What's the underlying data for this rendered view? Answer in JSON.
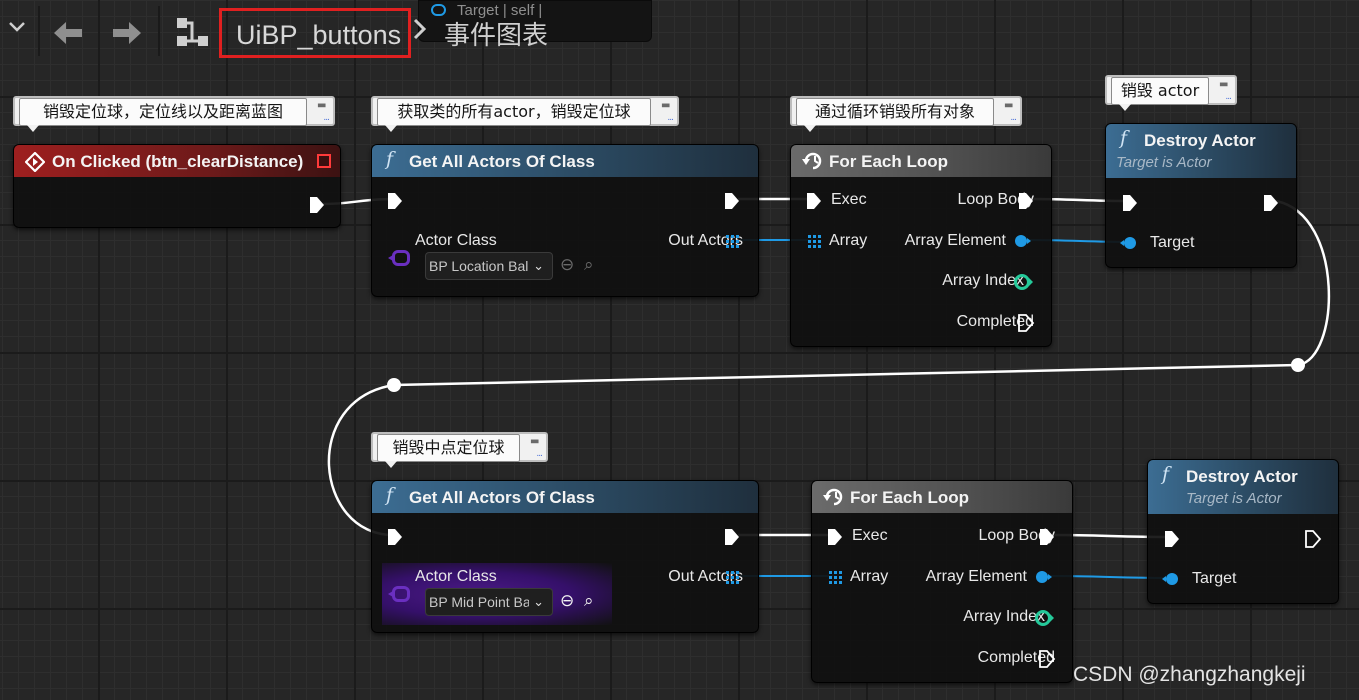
{
  "toolbar": {
    "breadcrumb_active": "UiBP_buttons",
    "breadcrumb_next": "事件图表",
    "stub_text": "Target | self |",
    "icons": [
      "chevron-down-icon",
      "back-arrow-icon",
      "forward-arrow-icon",
      "graph-hierarchy-icon"
    ]
  },
  "comments": {
    "c1": "销毁定位球，定位线以及距离蓝图",
    "c2": "获取类的所有actor，销毁定位球",
    "c3": "通过循环销毁所有对象",
    "c4": "销毁 actor",
    "c5": "销毁中点定位球"
  },
  "nodes": {
    "onclicked": {
      "title": "On Clicked (btn_clearDistance)"
    },
    "getall1": {
      "title": "Get All Actors Of Class",
      "in_class_label": "Actor Class",
      "out_label": "Out Actors",
      "class_value": "BP Location Bal"
    },
    "foreach1": {
      "title": "For Each Loop",
      "exec": "Exec",
      "array": "Array",
      "loop_body": "Loop Body",
      "element": "Array Element",
      "index": "Array Index",
      "completed": "Completed"
    },
    "destroy1": {
      "title": "Destroy Actor",
      "subtitle": "Target is Actor",
      "target": "Target"
    },
    "getall2": {
      "title": "Get All Actors Of Class",
      "in_class_label": "Actor Class",
      "out_label": "Out Actors",
      "class_value": "BP Mid Point Ba"
    },
    "foreach2": {
      "title": "For Each Loop",
      "exec": "Exec",
      "array": "Array",
      "loop_body": "Loop Body",
      "element": "Array Element",
      "index": "Array Index",
      "completed": "Completed"
    },
    "destroy2": {
      "title": "Destroy Actor",
      "subtitle": "Target is Actor",
      "target": "Target"
    }
  },
  "watermark": "CSDN @zhangzhangkeji",
  "colors": {
    "exec": "#ffffff",
    "object": "#1f9ae5",
    "integer": "#25c99a",
    "class": "#6a2fc0",
    "highlight": "#e02020"
  }
}
